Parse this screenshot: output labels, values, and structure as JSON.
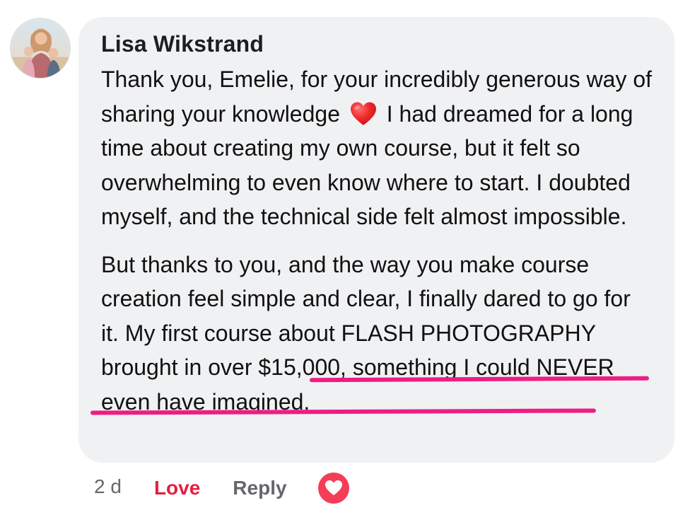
{
  "comment": {
    "author": "Lisa Wikstrand",
    "paragraph1_before_emoji": "Thank you, Emelie, for your incredibly generous way of sharing your knowledge",
    "paragraph1_after_emoji": "I had dreamed for a long time about creating my own course, but it felt so overwhelming to even know where to start. I doubted myself, and the technical side felt almost impossible.",
    "paragraph2_before_highlight": "But thanks to you, and the way you make course creation feel simple and clear, I finally dared to go for it.",
    "paragraph2_highlight": "My first course about FLASH PHOTOGRAPHY brought in over $15,000,",
    "paragraph2_after_highlight": "something I could NEVER even have imagined.",
    "emoji": "red-heart-icon"
  },
  "actions": {
    "timestamp": "2 d",
    "love_label": "Love",
    "reply_label": "Reply",
    "reaction": "love-reaction-icon"
  },
  "colors": {
    "bubble": "#f0f1f3",
    "love": "#e41e3f",
    "reaction": "#f33e58",
    "underline": "#ee1d84",
    "muted": "#65676b"
  }
}
